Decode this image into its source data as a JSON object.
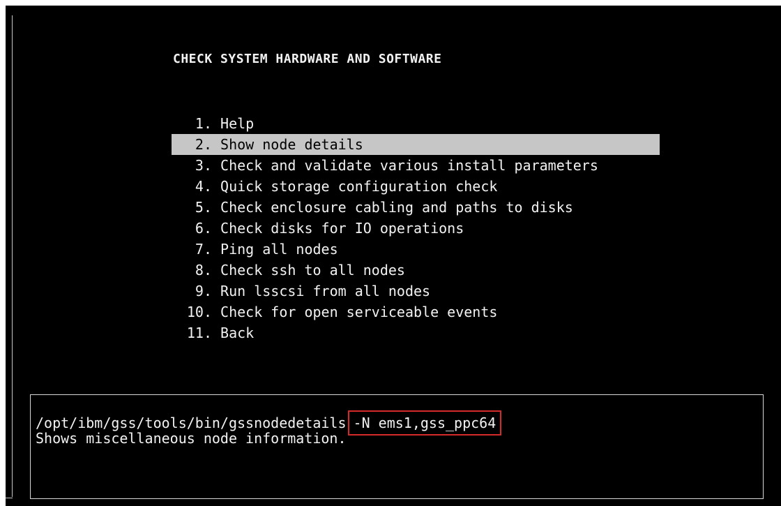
{
  "menu": {
    "title": "CHECK SYSTEM HARDWARE AND SOFTWARE",
    "items": [
      {
        "num": "1.",
        "label": "Help",
        "selected": false
      },
      {
        "num": "2.",
        "label": "Show node details",
        "selected": true
      },
      {
        "num": "3.",
        "label": "Check and validate various install parameters",
        "selected": false
      },
      {
        "num": "4.",
        "label": "Quick storage configuration check",
        "selected": false
      },
      {
        "num": "5.",
        "label": "Check enclosure cabling and paths to disks",
        "selected": false
      },
      {
        "num": "6.",
        "label": "Check disks for IO operations",
        "selected": false
      },
      {
        "num": "7.",
        "label": "Ping all nodes",
        "selected": false
      },
      {
        "num": "8.",
        "label": "Check ssh to all nodes",
        "selected": false
      },
      {
        "num": "9.",
        "label": "Run lsscsi from all nodes",
        "selected": false
      },
      {
        "num": "10.",
        "label": "Check for open serviceable events",
        "selected": false
      },
      {
        "num": "11.",
        "label": "Back",
        "selected": false
      }
    ]
  },
  "description": {
    "command": "/opt/ibm/gss/tools/bin/gssnodedetails",
    "args": "-N ems1,gss_ppc64",
    "summary": "Shows miscellaneous node information."
  },
  "colors": {
    "background": "#000000",
    "text": "#f2f2f2",
    "selection": "#c6c6c6",
    "annotation": "#d42a2a"
  }
}
